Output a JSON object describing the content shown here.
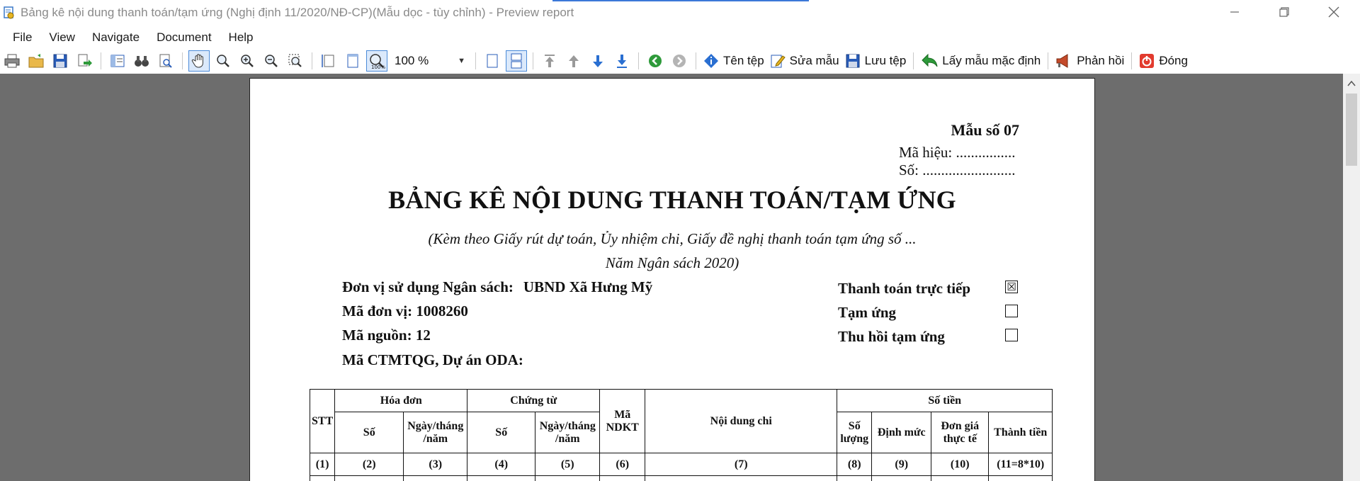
{
  "window": {
    "title": "Bảng kê nội dung thanh toán/tạm ứng (Nghị định 11/2020/NĐ-CP)(Mẫu dọc - tùy chỉnh) - Preview report"
  },
  "menu": [
    "File",
    "View",
    "Navigate",
    "Document",
    "Help"
  ],
  "toolbar": {
    "zoom": "100 %",
    "ten_tep": "Tên tệp",
    "sua_mau": "Sửa mẫu",
    "luu_tep": "Lưu tệp",
    "lay_mau": "Lấy mẫu mặc định",
    "phan_hoi": "Phản hồi",
    "dong": "Đóng"
  },
  "document": {
    "mau_so": "Mẫu số 07",
    "ma_hieu": "Mã hiệu: ................",
    "so": "Số: .........................",
    "title": "BẢNG KÊ NỘI DUNG THANH TOÁN/TẠM ỨNG",
    "subtitle1": "(Kèm theo Giấy rút dự toán, Ủy nhiệm chi, Giấy đề nghị thanh toán tạm ứng số ...",
    "subtitle2": "Năm Ngân sách 2020)",
    "don_vi_label": "Đơn vị sử dụng Ngân sách:",
    "don_vi_value": "UBND Xã Hưng Mỹ",
    "ma_don_vi": "Mã đơn vị: 1008260",
    "ma_nguon": "Mã nguồn: 12",
    "ma_ctmtqg": "Mã CTMTQG, Dự án ODA:",
    "options": [
      {
        "label": "Thanh toán trực tiếp",
        "checked": true
      },
      {
        "label": "Tạm ứng",
        "checked": false
      },
      {
        "label": "Thu hồi tạm ứng",
        "checked": false
      }
    ],
    "checkmark": "☒"
  },
  "table": {
    "stt": "STT",
    "hoa_don": "Hóa đơn",
    "chung_tu": "Chứng từ",
    "ma_ndkt": "Mã NDKT",
    "noi_dung_chi": "Nội dung chi",
    "so_tien": "Số tiền",
    "so": "Số",
    "ngay_thang_nam": "Ngày/tháng /năm",
    "so_luong": "Số lượng",
    "dinh_muc": "Định mức",
    "don_gia": "Đơn giá thực tế",
    "thanh_tien": "Thành tiền",
    "index_row": [
      "(1)",
      "(2)",
      "(3)",
      "(4)",
      "(5)",
      "(6)",
      "(7)",
      "(8)",
      "(9)",
      "(10)",
      "(11=8*10)"
    ]
  }
}
